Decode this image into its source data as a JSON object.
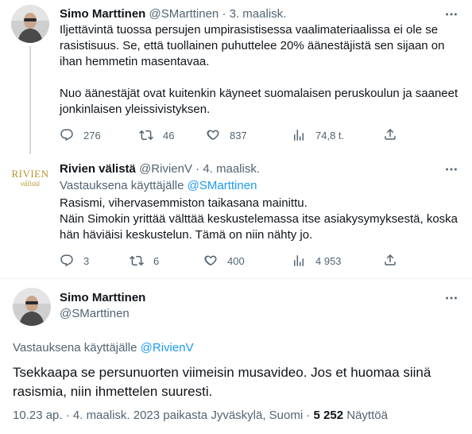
{
  "tweets": [
    {
      "author_name": "Simo Marttinen",
      "author_handle": "@SMarttinen",
      "separator": "·",
      "date": "3. maalisk.",
      "text": "Iljettävintä tuossa persujen umpirasistisessa vaalimateriaalissa ei ole se rasistisuus. Se, että tuollainen puhuttelee 20% äänestäjistä sen sijaan on ihan hemmetin masentavaa.\n\nNuo äänestäjät ovat kuitenkin käyneet suomalaisen peruskoulun ja saaneet jonkinlaisen yleissivistyksen.",
      "replies": "276",
      "retweets": "46",
      "likes": "837",
      "views": "74,8 t."
    },
    {
      "author_name": "Rivien välistä",
      "author_handle": "@RivienV",
      "separator": "·",
      "date": "4. maalisk.",
      "reply_prefix": "Vastauksena käyttäjälle ",
      "reply_to": "@SMarttinen",
      "text": "Rasismi, vihervasemmiston taikasana mainittu.\nNäin Simokin yrittää välttää keskustelemassa itse asiakysymyksestä, koska hän häviäisi keskustelun. Tämä on niin nähty jo.",
      "replies": "3",
      "retweets": "6",
      "likes": "400",
      "views": "4 953",
      "logo_line1": "RIVIEN",
      "logo_line2": "välistä"
    }
  ],
  "main_tweet": {
    "author_name": "Simo Marttinen",
    "author_handle": "@SMarttinen",
    "reply_prefix": "Vastauksena käyttäjälle ",
    "reply_to": "@RivienV",
    "text": "Tsekkaapa se persunuorten viimeisin musavideo. Jos et huomaa siinä rasismia, niin ihmettelen suuresti.",
    "timestamp": "10.23 ap. · 4. maalisk. 2023 paikasta Jyväskylä, Suomi · ",
    "view_count": "5 252",
    "view_label": " Näyttöä"
  },
  "icons": {
    "reply": "speech-bubble-icon",
    "retweet": "retweet-icon",
    "like": "heart-icon",
    "views": "bar-chart-icon",
    "share": "share-icon",
    "more": "more-dots-icon"
  },
  "colors": {
    "text": "#0f1419",
    "secondary": "#536471",
    "link": "#1d9bf0",
    "logo_gold": "#b8932d"
  }
}
